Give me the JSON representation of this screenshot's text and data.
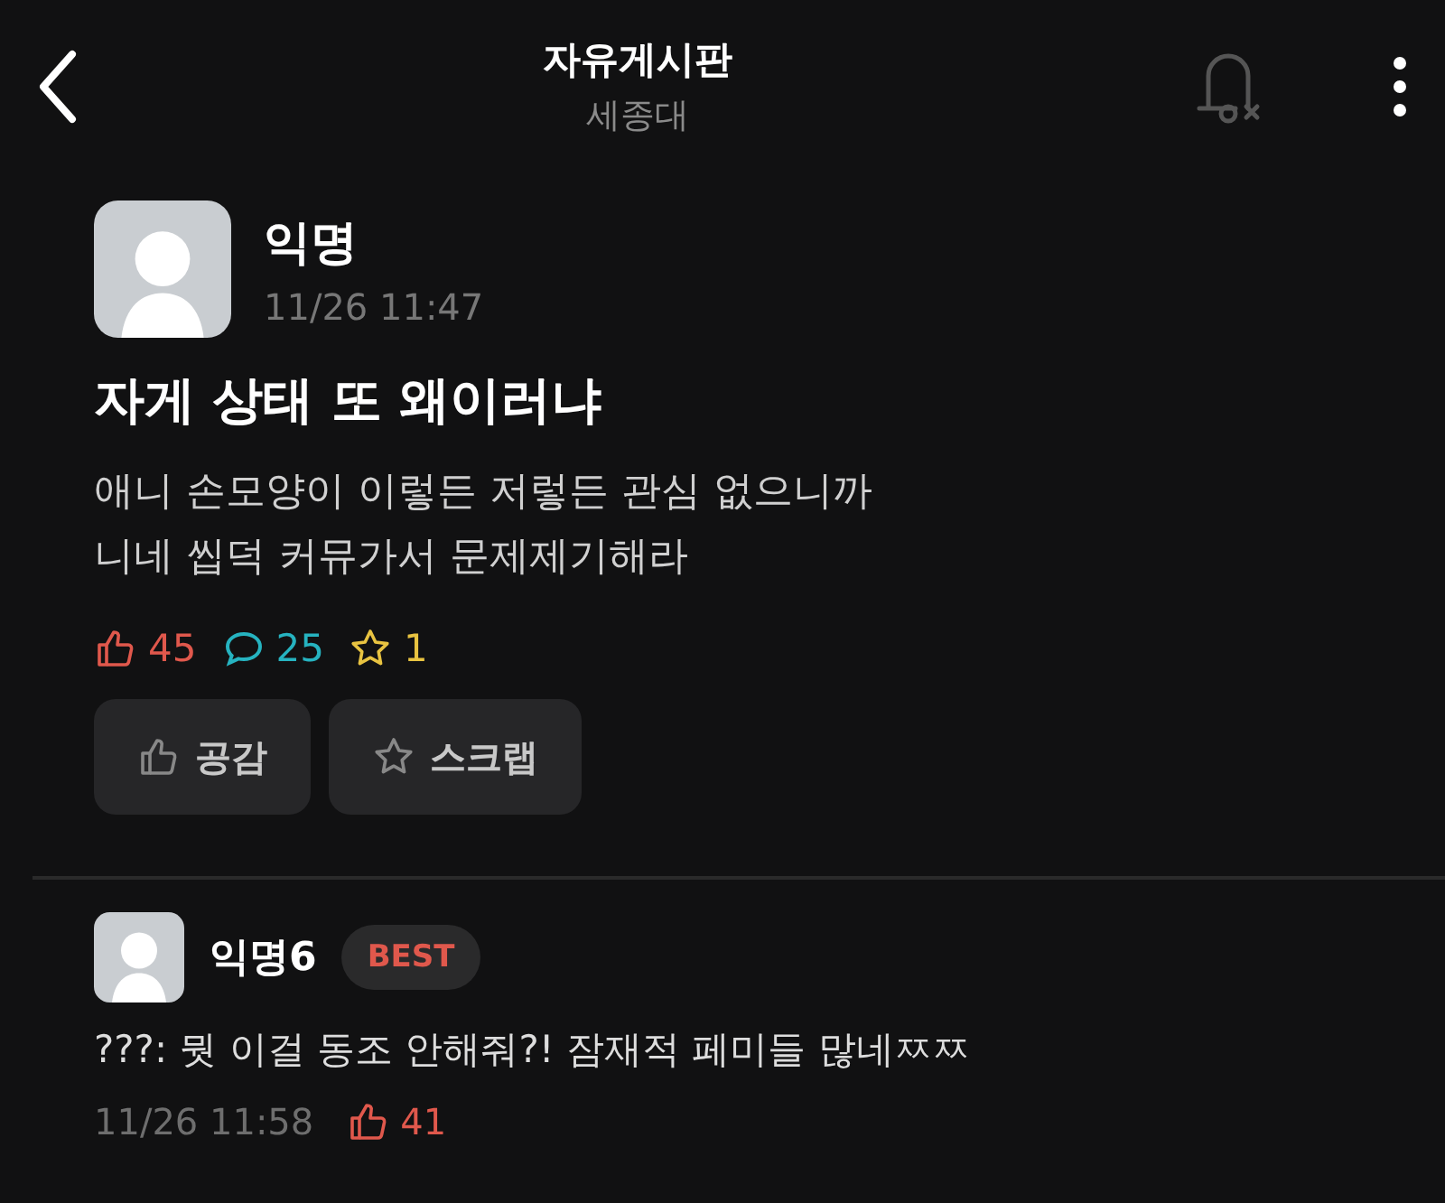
{
  "header": {
    "title": "자유게시판",
    "subtitle": "세종대"
  },
  "post": {
    "author": "익명",
    "time": "11/26 11:47",
    "title": "자게 상태 또 왜이러냐",
    "body": [
      "애니 손모양이 이렇든 저렇든 관심 없으니까",
      "니네 씹덕 커뮤가서 문제제기해라"
    ],
    "stats": {
      "likes": "45",
      "comments": "25",
      "scraps": "1"
    },
    "buttons": [
      {
        "kind": "like",
        "label": "공감"
      },
      {
        "kind": "scrap",
        "label": "스크랩"
      }
    ]
  },
  "comments": [
    {
      "author": "익명6",
      "badge": "BEST",
      "text": "???: 뭣 이걸 동조 안해줘?! 잠재적 페미들 많네ㅉㅉ",
      "time": "11/26 11:58",
      "likes": "41"
    }
  ]
}
